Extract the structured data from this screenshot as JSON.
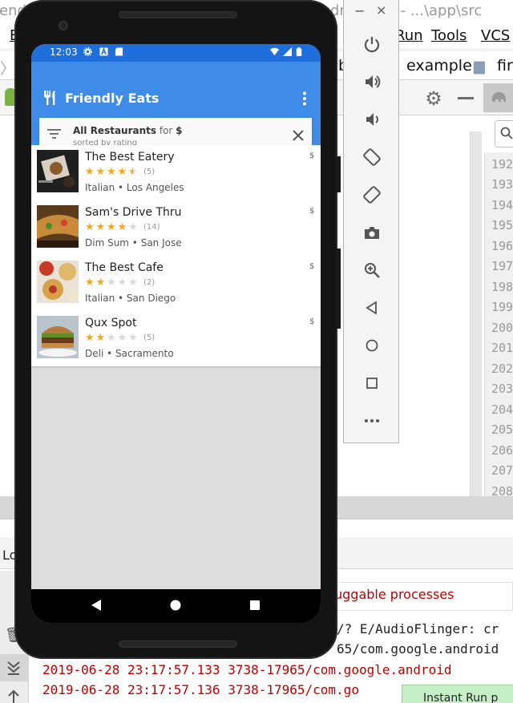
{
  "ide": {
    "title_left": "iend",
    "title_right": "dmdroid] - ...\\app\\src",
    "menu": [
      "E",
      "Run",
      "Tools",
      "VCS"
    ],
    "nav_example": "example",
    "nav_fire": "fire",
    "nav_b": "b",
    "line_numbers": [
      "192",
      "193",
      "194",
      "195",
      "196",
      "197",
      "198",
      "199",
      "200",
      "201",
      "202",
      "203",
      "204",
      "205",
      "206",
      "207",
      "208"
    ],
    "panel_label": "Lo",
    "debug_text": "uggable processes",
    "log_lines": [
      "/? E/AudioFlinger: cr",
      "65/com.google.android",
      "2019-06-28 23:17:57.133 3738-17965/com.google.android",
      "2019-06-28 23:17:57.136 3738-17965/com.go"
    ],
    "instant_run": "Instant Run p"
  },
  "emulator": {
    "minimize": "−",
    "close": "×",
    "buttons": [
      "power-icon",
      "volume-up-icon",
      "volume-down-icon",
      "rotate-left-icon",
      "rotate-right-icon",
      "camera-icon",
      "zoom-icon",
      "back-icon",
      "home-icon",
      "overview-icon",
      "more-icon"
    ]
  },
  "phone": {
    "status_time": "12:03",
    "app_title": "Friendly Eats",
    "filter": {
      "title_bold": "All Restaurants",
      "title_mid": " for ",
      "title_price": "$",
      "subtitle": "sorted by rating"
    },
    "restaurants": [
      {
        "name": "The Best Eatery",
        "price": "$",
        "rating": 4.5,
        "count": "(5)",
        "meta": "Italian • Los Angeles"
      },
      {
        "name": "Sam's Drive Thru",
        "price": "$",
        "rating": 4,
        "count": "(14)",
        "meta": "Dim Sum • San Jose"
      },
      {
        "name": "The Best Cafe",
        "price": "$",
        "rating": 2,
        "count": "(2)",
        "meta": "Italian • San Diego"
      },
      {
        "name": "Qux Spot",
        "price": "$",
        "rating": 2,
        "count": "(5)",
        "meta": "Deli • Sacramento"
      }
    ],
    "colors": {
      "statusbar": "#1e6edb",
      "appbar": "#3e8ce8",
      "star": "#f2a817",
      "star_empty": "#d9d9d9"
    }
  }
}
